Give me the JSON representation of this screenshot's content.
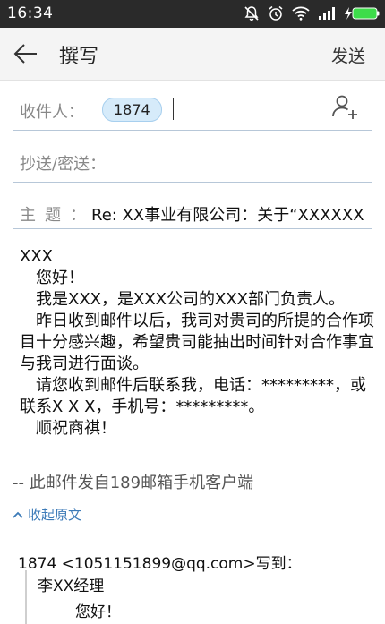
{
  "status_bar": {
    "time": "16:34",
    "icons": [
      "bell-off-icon",
      "alarm-icon",
      "wifi-icon",
      "signal-icon",
      "battery-charging-icon"
    ],
    "accent": "#3ddc4a"
  },
  "app_bar": {
    "title": "撰写",
    "send_label": "发送",
    "back_icon": "arrow-left-icon"
  },
  "compose": {
    "to_label": "收件人：",
    "recipient_chip": "1874",
    "add_contact_icon": "add-person-icon",
    "cc_label": "抄送/密送：",
    "subject_label": "主题：",
    "subject_value": "Re: XX事业有限公司：关于“XXXXXX"
  },
  "body": {
    "lines": [
      "XXX",
      "您好！",
      "我是XXX，是XXX公司的XXX部门负责人。",
      "昨日收到邮件以后，我司对贵司的所提的合作项目十分感兴趣，希望贵司能抽出时间针对合作事宜与我司进行面谈。",
      "请您收到邮件后联系我，电话：*********，或联系X X X，手机号：*********。",
      "顺祝商祺！"
    ]
  },
  "signature": "-- 此邮件发自189邮箱手机客户端",
  "collapse_label": "收起原文",
  "quoted": {
    "header": "1874 <1051151899@qq.com>写到：",
    "recipient": "李XX经理",
    "greeting": "您好！"
  },
  "colors": {
    "chip_bg": "#d6ebfa",
    "link": "#3d7bb8",
    "divider": "#b7c7d8"
  }
}
